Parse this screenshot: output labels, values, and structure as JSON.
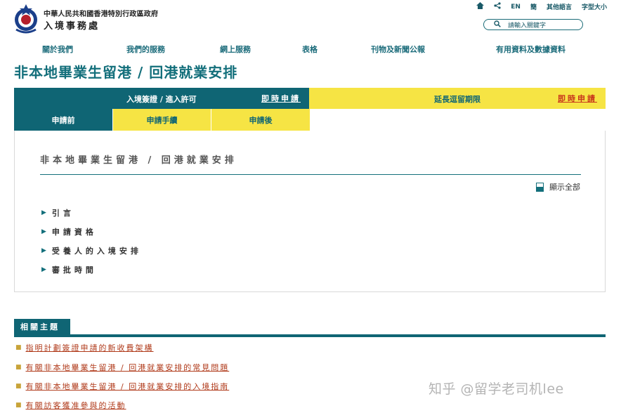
{
  "header": {
    "dept_line1": "中華人民共和國香港特別行政區政府",
    "dept_line2": "入境事務處",
    "utility": {
      "home_icon": "home-icon",
      "share_icon": "share-icon",
      "lang_en": "EN",
      "lang_sc": "簡",
      "other_lang": "其他語言",
      "font_size": "字型大小"
    },
    "search": {
      "placeholder": "請輸入關鍵字",
      "icon": "search-icon"
    }
  },
  "nav": {
    "items": [
      "關於我們",
      "我們的服務",
      "網上服務",
      "表格",
      "刊物及新聞公報",
      "有用資料及數據資料"
    ]
  },
  "page_title": "非本地畢業生留港 / 回港就業安排",
  "tabs": {
    "tab1": {
      "label": "入境簽證 / 進入許可",
      "apply": "即時申請"
    },
    "tab2": {
      "label": "延長逗留期限",
      "apply": "即時申請"
    },
    "sub": [
      "申請前",
      "申請手續",
      "申請後"
    ]
  },
  "panel": {
    "title": "非本地畢業生留港 / 回港就業安排",
    "show_all": "顯示全部",
    "items": [
      "引言",
      "申請資格",
      "受養人的入境安排",
      "審批時間"
    ]
  },
  "related": {
    "title": "相關主題",
    "links": [
      "指明計劃簽證申請的新收費架構",
      "有關非本地畢業生留港 / 回港就業安排的常見問題",
      "有關非本地畢業生留港 / 回港就業安排的入境指南",
      "有關訪客獲准參與的活動"
    ]
  },
  "watermark": "知乎 @留学老司机lee",
  "colors": {
    "teal": "#0f6574",
    "yellow": "#f6e444",
    "link_red": "#b03a1a"
  }
}
